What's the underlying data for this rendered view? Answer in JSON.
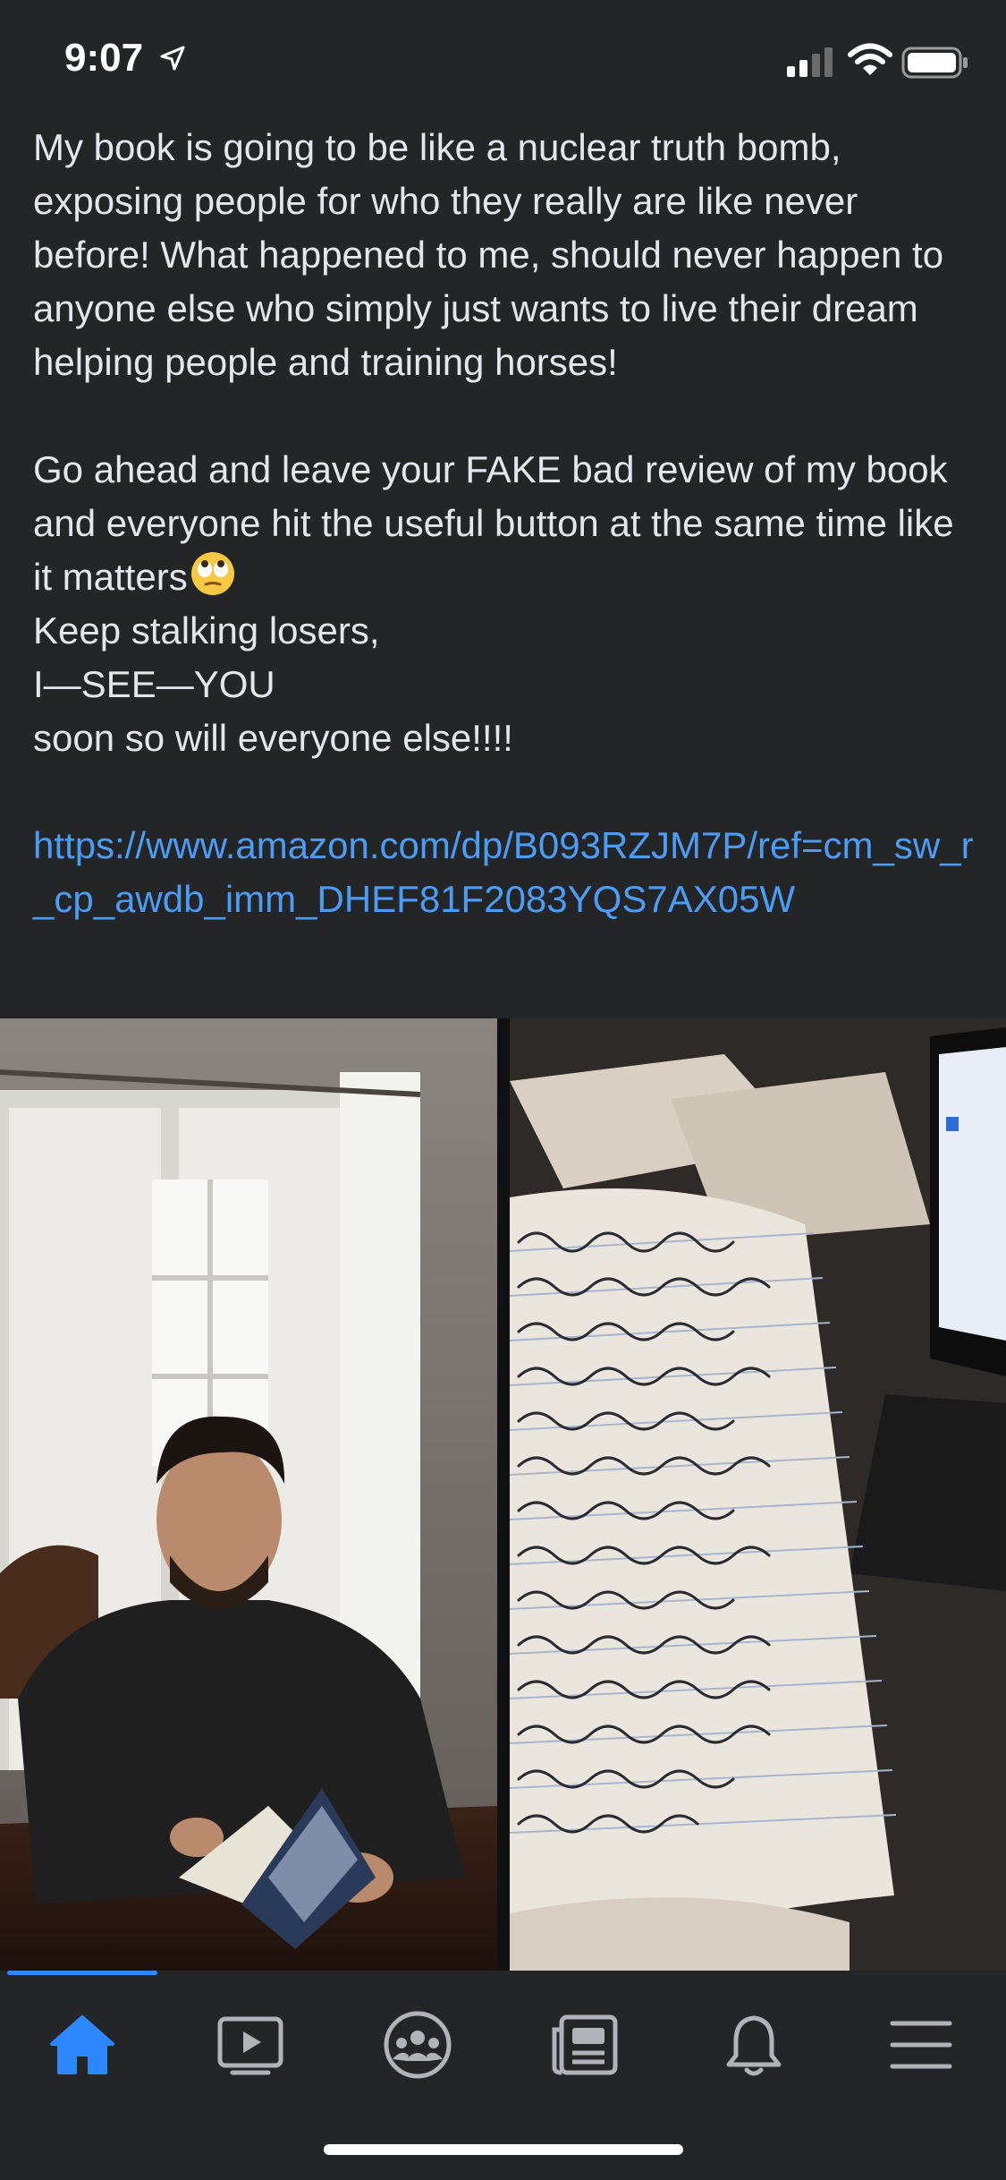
{
  "status_bar": {
    "time": "9:07"
  },
  "post": {
    "paragraph1": "My book is going to be like a nuclear truth bomb, exposing people for who they really are like never before! What happened to me, should never happen to anyone else who simply just wants to live their dream helping people and training horses!",
    "paragraph2_line1": "Go ahead and leave your FAKE bad review of my book and everyone hit the useful button at the same time like it matters",
    "line_stalking": "Keep stalking losers,",
    "line_see_you": "I—SEE—YOU",
    "line_soon": "soon so will everyone else!!!!",
    "link_text": "https://www.amazon.com/dp/B093RZJM7P/ref=cm_sw_r_cp_awdb_imm_DHEF81F2083YQS7AX05W"
  },
  "emoji": "face-with-rolling-eyes-icon",
  "tab_bar": {
    "active": "home",
    "tabs": [
      "home",
      "watch",
      "groups",
      "news",
      "notifications",
      "menu"
    ]
  },
  "colors": {
    "background": "#242526",
    "text": "#e4e6eb",
    "link": "#4b9cf5",
    "accent": "#2d88ff",
    "inactive_icon": "#b0b3b8"
  }
}
